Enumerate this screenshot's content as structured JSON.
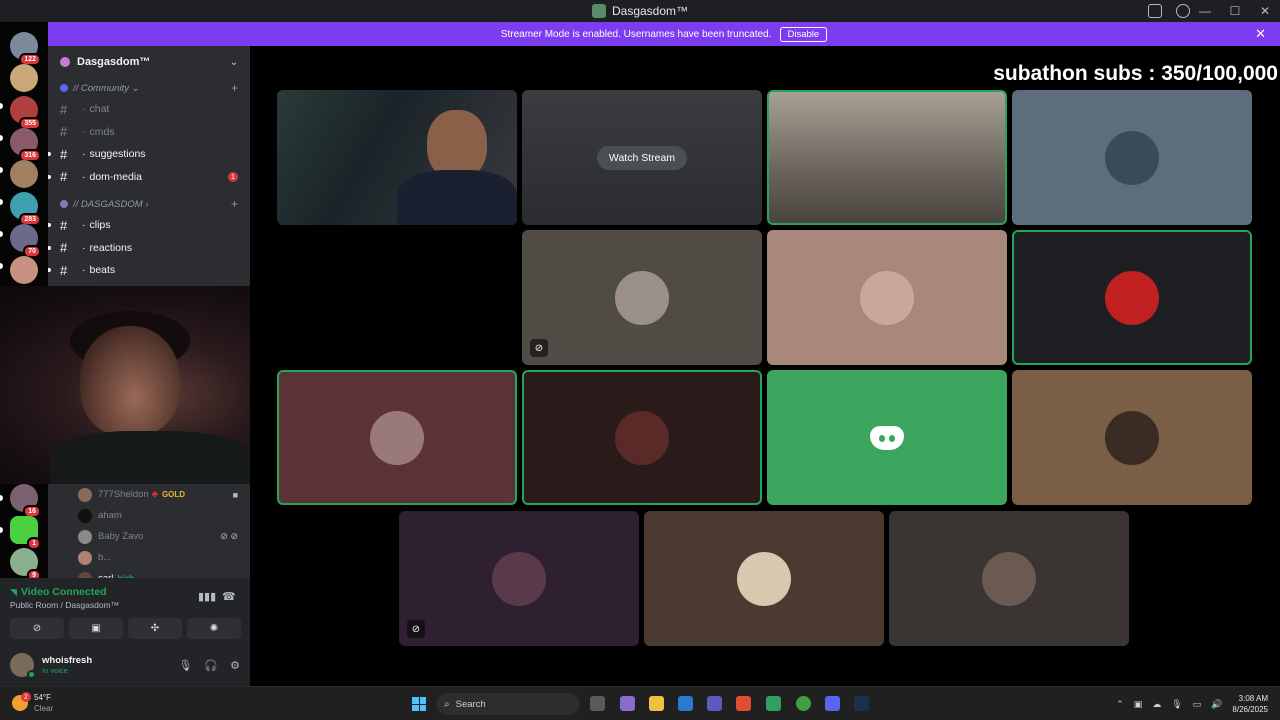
{
  "window": {
    "title": "Dasgasdom™"
  },
  "banner": {
    "text": "Streamer Mode is enabled. Usernames have been truncated.",
    "disable_label": "Disable"
  },
  "servers": [
    {
      "badge": "122",
      "color": "#7a8a9a"
    },
    {
      "badge": "",
      "color": "#c8a878"
    },
    {
      "badge": "355",
      "color": "#b04040"
    },
    {
      "badge": "316",
      "color": "#8a5a6a"
    },
    {
      "badge": "",
      "color": "#a08060"
    },
    {
      "badge": "283",
      "color": "#40a0b0"
    },
    {
      "badge": "70",
      "color": "#6a6a8a"
    },
    {
      "badge": "",
      "color": "#c89080"
    },
    {
      "badge": "16",
      "color": "#7a6070"
    },
    {
      "badge": "1",
      "color": "#4ad040"
    },
    {
      "badge": "9",
      "color": "#8ab090"
    }
  ],
  "server": {
    "name": "Dasgasdom™"
  },
  "categories": [
    {
      "name": "// Community",
      "suffix": "⌄"
    },
    {
      "name": "// DASGASDOM",
      "suffix": "›"
    }
  ],
  "channels": [
    {
      "name": "chat",
      "unread": false,
      "badge": ""
    },
    {
      "name": "cmds",
      "unread": false,
      "badge": ""
    },
    {
      "name": "suggestions",
      "unread": true,
      "badge": ""
    },
    {
      "name": "dom-media",
      "unread": true,
      "badge": "1"
    },
    {
      "name": "clips",
      "unread": true,
      "badge": ""
    },
    {
      "name": "reactions",
      "unread": true,
      "badge": ""
    },
    {
      "name": "beats",
      "unread": true,
      "badge": ""
    }
  ],
  "members": [
    {
      "name": "777Sheldon",
      "tag": "GOLD",
      "tag_color": "#f0b232",
      "icon": "🎥"
    },
    {
      "name": "aham",
      "tag": "",
      "tag_color": "",
      "icon": ""
    },
    {
      "name": "Baby Zavo",
      "tag": "",
      "tag_color": "",
      "icon": "⊘ ⊘"
    },
    {
      "name": "b...",
      "tag": "",
      "tag_color": "",
      "icon": ""
    },
    {
      "name": "carl",
      "tag": "high",
      "tag_color": "#23a55a",
      "icon": ""
    }
  ],
  "voice": {
    "status": "Video Connected",
    "room": "Public Room / Dasgasdom™"
  },
  "user": {
    "name": "whoisfresh",
    "status": "In voice"
  },
  "stage": {
    "overlay_text": "subathon subs : 350/100,000",
    "watch_label": "Watch Stream"
  },
  "taskbar": {
    "temp": "54°F",
    "condition": "Clear",
    "weather_badge": "2",
    "search_placeholder": "Search",
    "time": "3:08 AM",
    "date": "8/26/2025"
  },
  "colors": {
    "accent": "#7d3cf0",
    "speaking": "#23a55a",
    "discord_green": "#3ba55d"
  }
}
